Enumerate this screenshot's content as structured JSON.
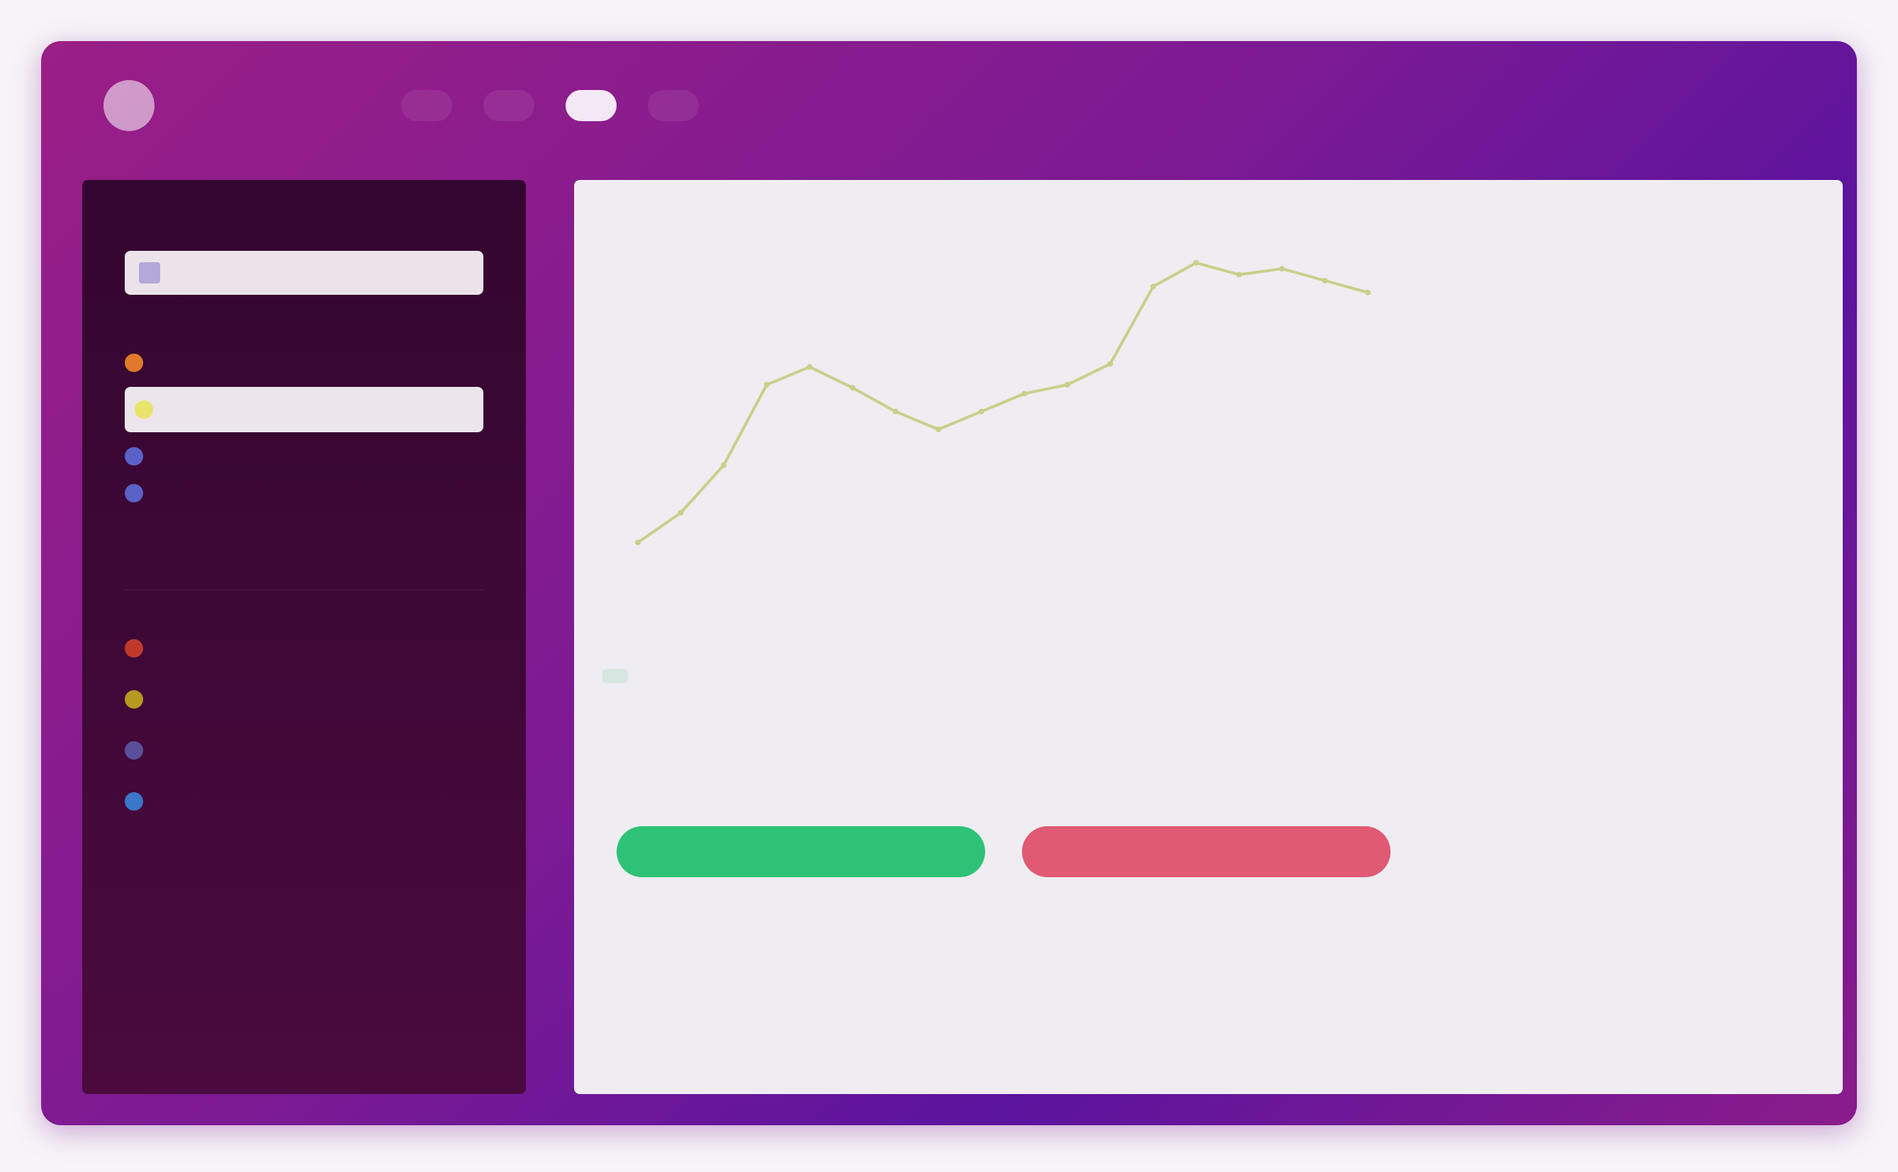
{
  "app": {
    "logo_letter": "",
    "brand": "",
    "top_right": ""
  },
  "nav": [
    {
      "label": ""
    },
    {
      "label": ""
    },
    {
      "label": ""
    },
    {
      "label": ""
    },
    {
      "label": ""
    }
  ],
  "sidebar": {
    "title": "",
    "search_placeholder": "",
    "section_label": "",
    "assets": [
      {
        "label": "",
        "value": "",
        "color": "#e07a2a"
      },
      {
        "label": "",
        "value": "",
        "color": "#e9e46a"
      },
      {
        "label": "",
        "value": "",
        "color": "#5a62c8"
      },
      {
        "label": "",
        "value": "",
        "color": "#5a62c8"
      }
    ],
    "legend": [
      {
        "label": "",
        "value": "",
        "color": "#c0392b"
      },
      {
        "label": "",
        "value": "",
        "color": "#b59a1f"
      },
      {
        "label": "",
        "value": "",
        "color": "#5a4f9a"
      },
      {
        "label": "",
        "value": "",
        "color": "#3a77c8"
      }
    ]
  },
  "chart": {
    "title": "",
    "ranges": [
      "",
      "",
      "",
      "",
      ""
    ],
    "timeframes": [
      "",
      "",
      "",
      "",
      ""
    ],
    "active_timeframe": 0
  },
  "chart_data": {
    "type": "line",
    "x": [],
    "series": [
      {
        "values": [
          2,
          12,
          28,
          55,
          61,
          54,
          46,
          40,
          46,
          52,
          55,
          62,
          88,
          96,
          92,
          94,
          90,
          86
        ]
      }
    ],
    "line_color": "#c9cf8a",
    "ylim": [
      0,
      100
    ]
  },
  "orderbook": {
    "title": "",
    "headers": [
      "",
      "",
      ""
    ],
    "rows": [
      [
        "",
        "",
        ""
      ],
      [
        "",
        "",
        ""
      ],
      [
        "",
        "",
        ""
      ],
      [
        "",
        "",
        ""
      ],
      [
        "",
        "",
        ""
      ],
      [
        "",
        "",
        ""
      ],
      [
        "",
        "",
        ""
      ],
      [
        "",
        "",
        ""
      ]
    ]
  },
  "buy_form": {
    "title": "",
    "rows": [
      {
        "label": "",
        "value": ""
      },
      {
        "label": "",
        "value": ""
      },
      {
        "label": "",
        "value": ""
      }
    ],
    "button": ""
  },
  "sell_form": {
    "title": "",
    "rows": [
      {
        "label": "",
        "value": ""
      },
      {
        "label": "",
        "value": ""
      },
      {
        "label": "",
        "value": ""
      }
    ],
    "button": ""
  },
  "trades": {
    "title": "",
    "rows": [
      {
        "a": "",
        "b": "",
        "c": "",
        "dir": "n"
      },
      {
        "a": "",
        "b": "",
        "c": "",
        "dir": "up"
      },
      {
        "a": "",
        "b": "",
        "c": "",
        "dir": "down"
      },
      {
        "a": "",
        "b": "",
        "c": "",
        "dir": "up"
      }
    ]
  }
}
